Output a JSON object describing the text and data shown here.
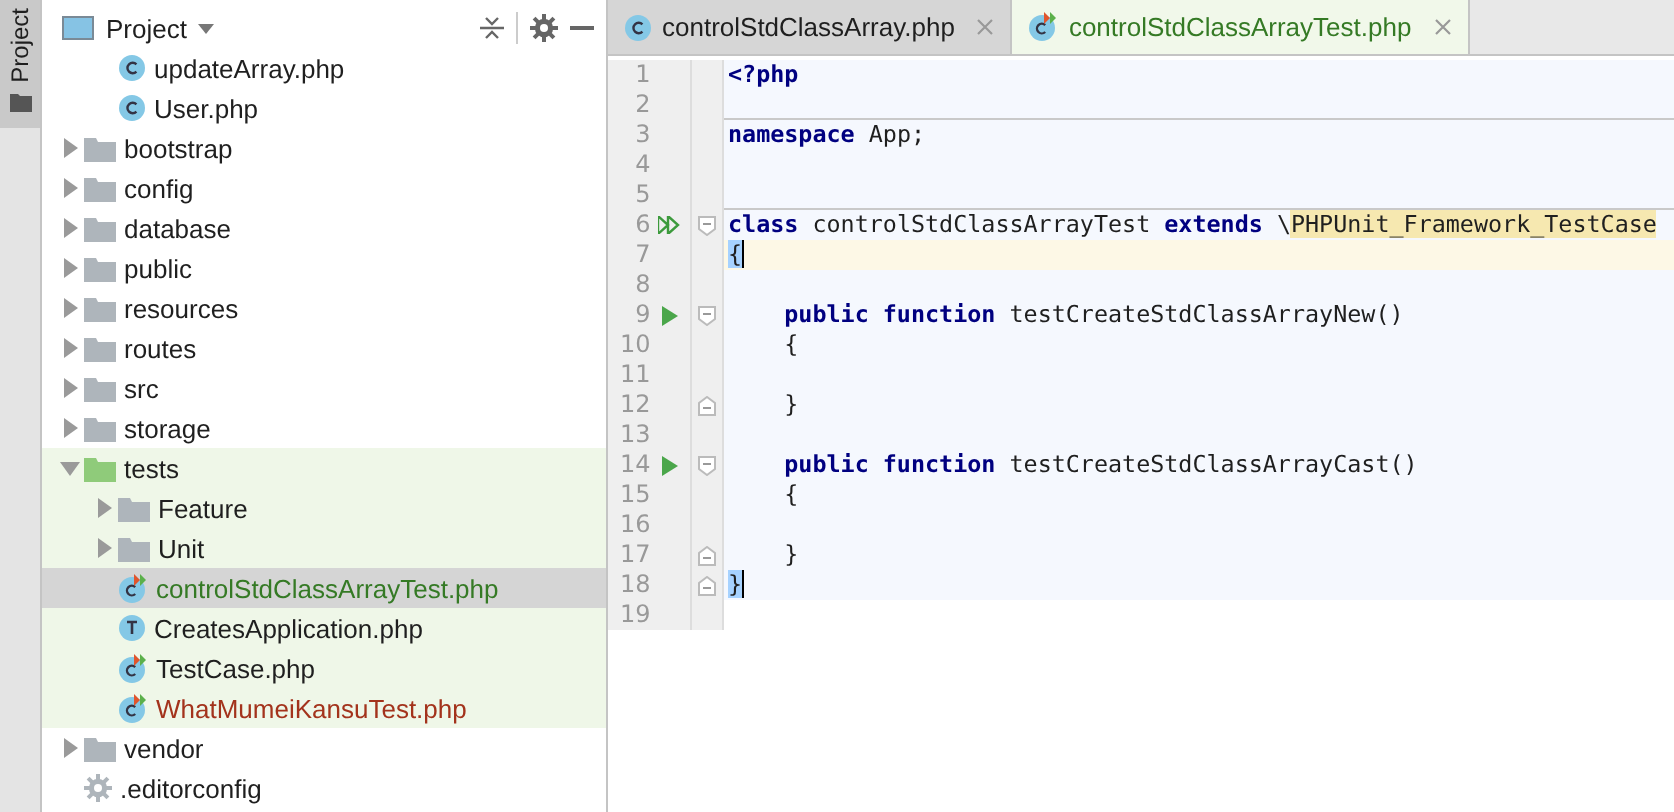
{
  "side_strip": {
    "tab": {
      "label": "Project",
      "selected": true
    }
  },
  "project_panel": {
    "title": "Project",
    "tree": [
      {
        "kind": "hidden",
        "children": [
          {
            "kind": "class",
            "label": "updateArray.php",
            "color": "#1f1f1f",
            "selected": false
          },
          {
            "kind": "class",
            "label": "User.php",
            "color": "#1f1f1f",
            "selected": false
          }
        ]
      },
      {
        "kind": "folder",
        "label": "bootstrap",
        "expanded": false,
        "selected": false
      },
      {
        "kind": "folder",
        "label": "config",
        "expanded": false,
        "selected": false
      },
      {
        "kind": "folder",
        "label": "database",
        "expanded": false,
        "selected": false
      },
      {
        "kind": "folder",
        "label": "public",
        "expanded": false,
        "selected": false
      },
      {
        "kind": "folder",
        "label": "resources",
        "expanded": false,
        "selected": false
      },
      {
        "kind": "folder",
        "label": "routes",
        "expanded": false,
        "selected": false
      },
      {
        "kind": "folder",
        "label": "src",
        "expanded": false,
        "selected": false
      },
      {
        "kind": "folder",
        "label": "storage",
        "expanded": false,
        "selected": false
      },
      {
        "kind": "test_folder",
        "label": "tests",
        "expanded": true,
        "selected": false,
        "children": [
          {
            "kind": "folder",
            "label": "Feature",
            "expanded": false,
            "selected": false
          },
          {
            "kind": "folder",
            "label": "Unit",
            "expanded": false,
            "selected": false
          },
          {
            "kind": "test",
            "label": "controlStdClassArrayTest.php",
            "color": "#357a25",
            "selected": true
          },
          {
            "kind": "trait",
            "label": "CreatesApplication.php",
            "color": "#1f1f1f",
            "selected": false
          },
          {
            "kind": "test",
            "label": "TestCase.php",
            "color": "#1f1f1f",
            "selected": false
          },
          {
            "kind": "test",
            "label": "WhatMumeiKansuTest.php",
            "color": "#a3331c",
            "selected": false
          }
        ]
      },
      {
        "kind": "folder",
        "label": "vendor",
        "expanded": false,
        "selected": false
      },
      {
        "kind": "config",
        "label": ".editorconfig",
        "color": "#1f1f1f",
        "selected": false
      }
    ]
  },
  "editor": {
    "tabs": [
      {
        "kind": "class",
        "label": "controlStdClassArray.php",
        "color": "#1f1f1f",
        "selected": false
      },
      {
        "kind": "test",
        "label": "controlStdClassArrayTest.php",
        "color": "#357a25",
        "selected": true
      }
    ],
    "lines": [
      {
        "number": "1",
        "kind": "plain",
        "current": false,
        "tokens": [
          {
            "kind": "keyword",
            "text": "<?php"
          }
        ]
      },
      {
        "number": "2",
        "kind": "separator",
        "current": false
      },
      {
        "number": "3",
        "kind": "plain",
        "current": false,
        "tokens": [
          {
            "kind": "keyword",
            "text": "namespace"
          },
          {
            "kind": "plain",
            "text": " App;"
          }
        ]
      },
      {
        "number": "4",
        "kind": "plain",
        "current": false
      },
      {
        "number": "5",
        "kind": "separator",
        "current": false
      },
      {
        "number": "6",
        "kind": "class_start",
        "current": false,
        "tokens": [
          {
            "kind": "keyword",
            "text": "class"
          },
          {
            "kind": "plain",
            "text": " controlStdClassArrayTest "
          },
          {
            "kind": "keyword",
            "text": "extends"
          },
          {
            "kind": "plain",
            "text": " \\"
          },
          {
            "kind": "highlight",
            "text": "PHPUnit_Framework_TestCase"
          }
        ]
      },
      {
        "number": "7",
        "kind": "plain",
        "current": true,
        "tokens": [
          {
            "kind": "brace",
            "text": "{"
          }
        ]
      },
      {
        "number": "8",
        "kind": "plain",
        "current": false
      },
      {
        "number": "9",
        "kind": "method_start",
        "current": false,
        "tokens": [
          {
            "kind": "keyword",
            "text": "public function"
          },
          {
            "kind": "plain",
            "text": " testCreateStdClassArrayNew()"
          }
        ]
      },
      {
        "number": "10",
        "kind": "method_body",
        "current": false,
        "tokens": [
          {
            "kind": "plain",
            "text": "{"
          }
        ]
      },
      {
        "number": "11",
        "kind": "plain",
        "current": false
      },
      {
        "number": "12",
        "kind": "method_end",
        "current": false,
        "tokens": [
          {
            "kind": "plain",
            "text": "}"
          }
        ]
      },
      {
        "number": "13",
        "kind": "plain",
        "current": false
      },
      {
        "number": "14",
        "kind": "method_start",
        "current": false,
        "tokens": [
          {
            "kind": "keyword",
            "text": "public function"
          },
          {
            "kind": "plain",
            "text": " testCreateStdClassArrayCast()"
          }
        ]
      },
      {
        "number": "15",
        "kind": "method_body",
        "current": false,
        "tokens": [
          {
            "kind": "plain",
            "text": "{"
          }
        ]
      },
      {
        "number": "16",
        "kind": "plain",
        "current": false
      },
      {
        "number": "17",
        "kind": "method_end",
        "current": false,
        "tokens": [
          {
            "kind": "plain",
            "text": "}"
          }
        ]
      },
      {
        "number": "18",
        "kind": "class_end",
        "current": false,
        "tokens": [
          {
            "kind": "brace",
            "text": "}"
          }
        ]
      },
      {
        "number": "19",
        "kind": "outside",
        "current": false
      }
    ]
  }
}
